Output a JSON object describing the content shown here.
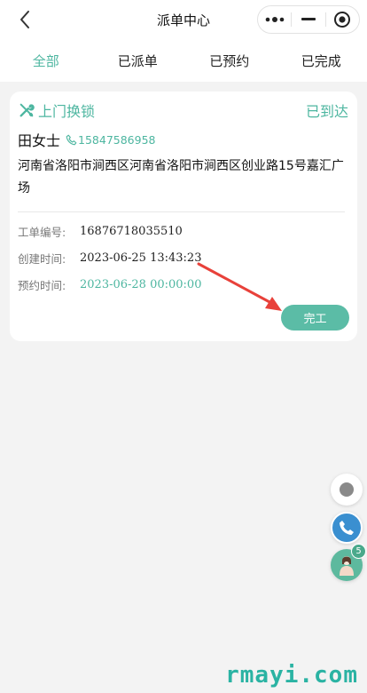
{
  "navbar": {
    "title": "派单中心",
    "back_icon": "chevron-left-icon",
    "more_icon": "more-dots-icon",
    "minimize_icon": "minimize-icon",
    "close_icon": "target-circle-icon"
  },
  "tabs": [
    {
      "label": "全部",
      "active": true
    },
    {
      "label": "已派单",
      "active": false
    },
    {
      "label": "已预约",
      "active": false
    },
    {
      "label": "已完成",
      "active": false
    }
  ],
  "order": {
    "service_icon": "tools-icon",
    "service_name": "上门换锁",
    "status": "已到达",
    "customer_name": "田女士",
    "phone_icon": "phone-icon",
    "phone": "15847586958",
    "address": "河南省洛阳市涧西区河南省洛阳市涧西区创业路15号嘉汇广场",
    "order_no_label": "工单编号:",
    "order_no": "16876718035510",
    "created_label": "创建时间:",
    "created": "2023-06-25 13:43:23",
    "appointment_label": "预约时间:",
    "appointment": "2023-06-28 00:00:00",
    "complete_button": "完工"
  },
  "float_buttons": {
    "record_icon": "record-dot-icon",
    "call_icon": "phone-call-icon",
    "avatar_icon": "service-avatar-icon",
    "badge_count": "5"
  },
  "watermark": "rmayi.com",
  "colors": {
    "accent": "#4db6a0",
    "background": "#f3f3f3",
    "arrow": "#e8413a"
  }
}
